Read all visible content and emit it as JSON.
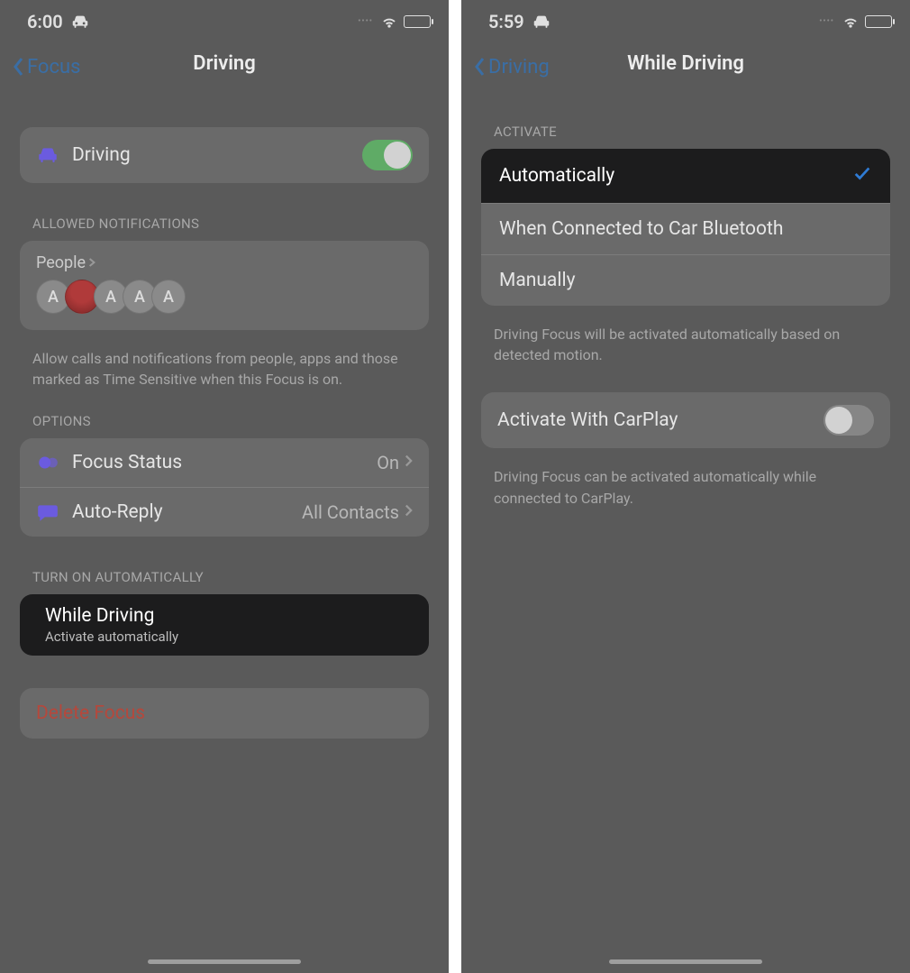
{
  "left": {
    "status": {
      "time": "6:00"
    },
    "nav": {
      "back": "Focus",
      "title": "Driving"
    },
    "drivingRow": {
      "label": "Driving",
      "toggleOn": true
    },
    "allowed": {
      "header": "ALLOWED NOTIFICATIONS",
      "peopleLabel": "People",
      "avatars": [
        "A",
        "",
        "A",
        "A",
        "A"
      ],
      "footer": "Allow calls and notifications from people, apps and those marked as Time Sensitive when this Focus is on."
    },
    "options": {
      "header": "OPTIONS",
      "focusStatus": {
        "label": "Focus Status",
        "value": "On"
      },
      "autoReply": {
        "label": "Auto-Reply",
        "value": "All Contacts"
      }
    },
    "auto": {
      "header": "TURN ON AUTOMATICALLY",
      "title": "While Driving",
      "sub": "Activate automatically"
    },
    "delete": "Delete Focus"
  },
  "right": {
    "status": {
      "time": "5:59"
    },
    "nav": {
      "back": "Driving",
      "title": "While Driving"
    },
    "activate": {
      "header": "ACTIVATE",
      "options": [
        "Automatically",
        "When Connected to Car Bluetooth",
        "Manually"
      ],
      "selectedIndex": 0,
      "footer": "Driving Focus will be activated automatically based on detected motion."
    },
    "carplay": {
      "label": "Activate With CarPlay",
      "toggleOn": false,
      "footer": "Driving Focus can be activated automatically while connected to CarPlay."
    }
  }
}
